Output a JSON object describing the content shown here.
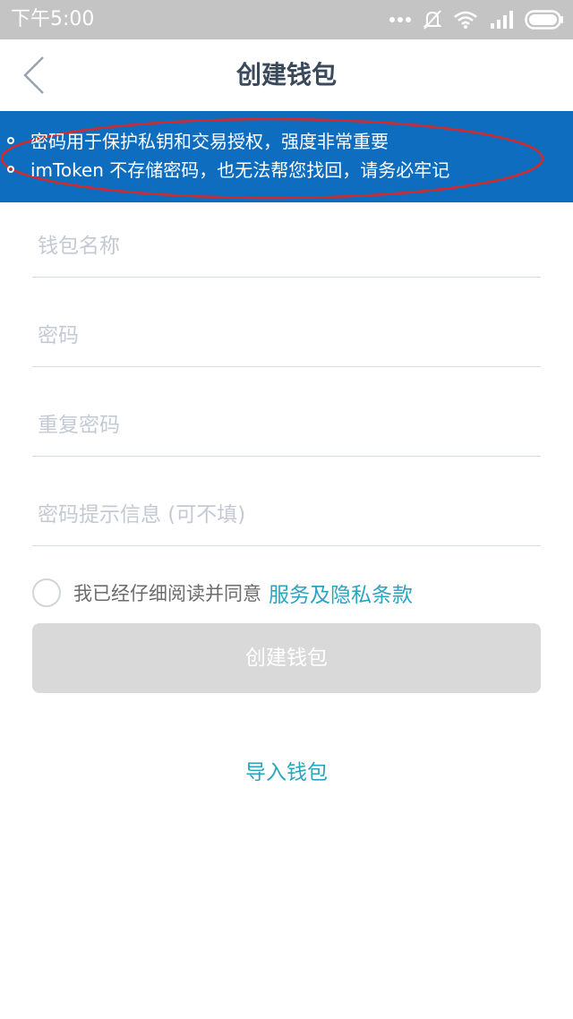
{
  "status_bar": {
    "time": "下午5:00",
    "icons": [
      "more-dots-icon",
      "bell-off-icon",
      "wifi-icon",
      "signal-icon",
      "battery-icon"
    ]
  },
  "nav": {
    "title": "创建钱包",
    "back_icon": "chevron-left-icon"
  },
  "notice": {
    "items": [
      "密码用于保护私钥和交易授权，强度非常重要",
      "imToken 不存储密码，也无法帮您找回，请务必牢记"
    ],
    "background": "#0e6dbf",
    "annotation_color": "#d42a2a"
  },
  "form": {
    "wallet_name_placeholder": "钱包名称",
    "password_placeholder": "密码",
    "repeat_password_placeholder": "重复密码",
    "hint_placeholder": "密码提示信息 (可不填)"
  },
  "agreement": {
    "text": "我已经仔细阅读并同意",
    "link": "服务及隐私条款",
    "checked": false
  },
  "buttons": {
    "create_label": "创建钱包",
    "import_label": "导入钱包"
  },
  "colors": {
    "accent": "#2ba5bf",
    "disabled_button": "#d9d9d9",
    "title": "#3a4a5c"
  }
}
